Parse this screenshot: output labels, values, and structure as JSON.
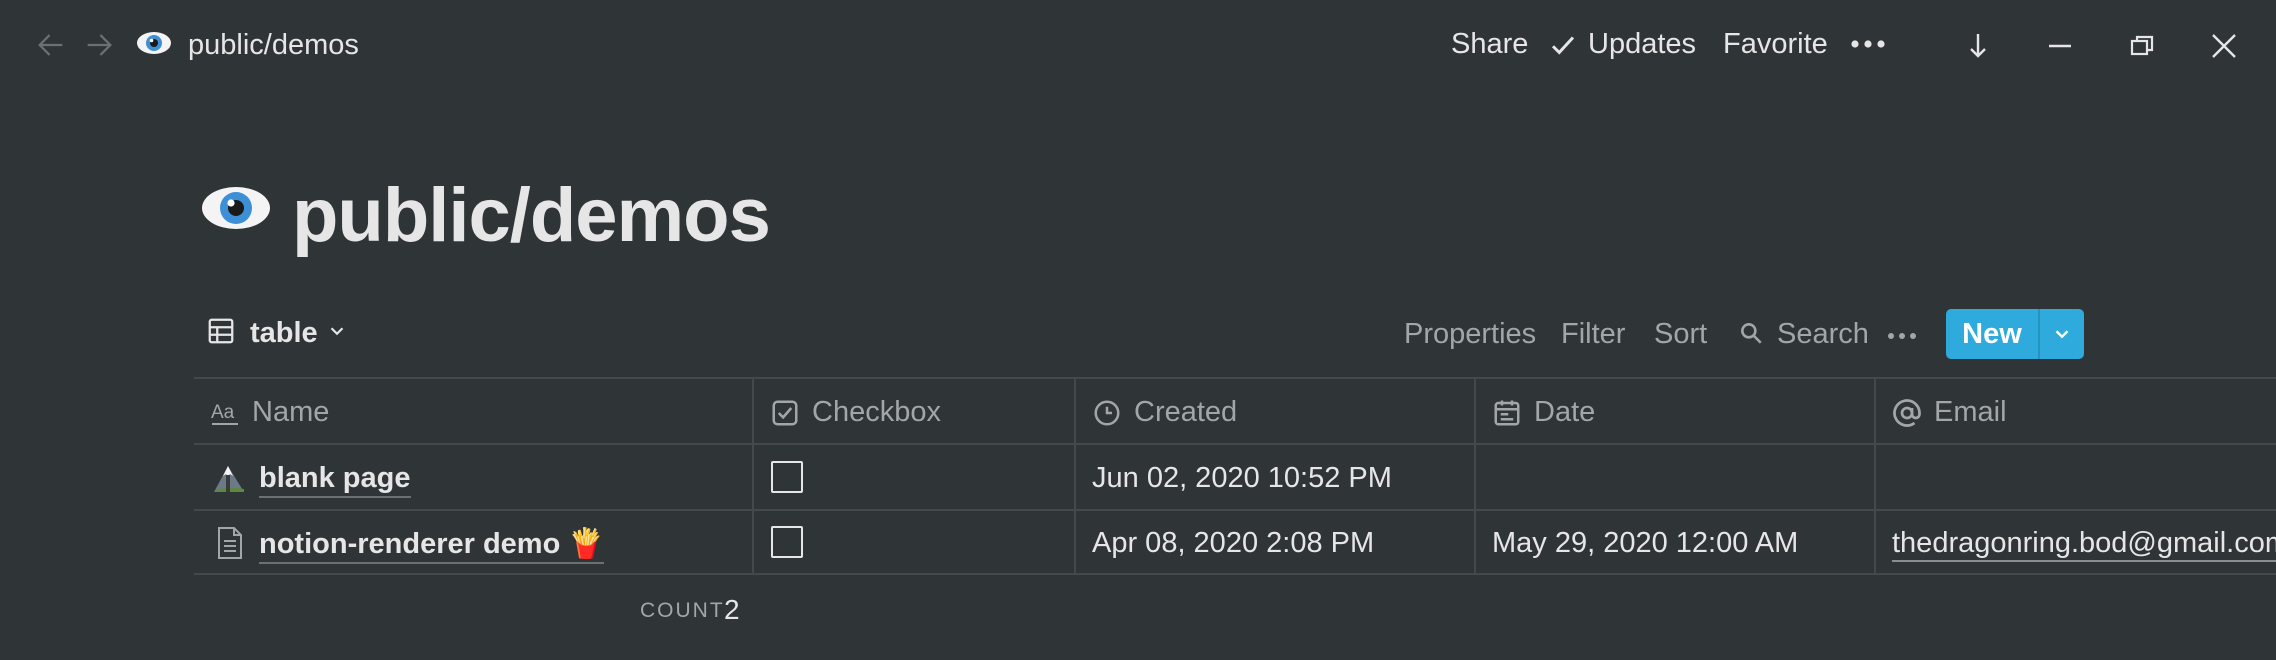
{
  "topbar": {
    "breadcrumb": "public/demos",
    "share": "Share",
    "updates": "Updates",
    "favorite": "Favorite"
  },
  "page": {
    "title": "public/demos",
    "icon": "eye-emoji"
  },
  "view": {
    "label": "table",
    "toolbar": {
      "properties": "Properties",
      "filter": "Filter",
      "sort": "Sort",
      "search": "Search",
      "new": "New"
    }
  },
  "table": {
    "columns": [
      {
        "label": "Name",
        "icon": "text-aa-icon"
      },
      {
        "label": "Checkbox",
        "icon": "checkbox-icon"
      },
      {
        "label": "Created",
        "icon": "clock-icon"
      },
      {
        "label": "Date",
        "icon": "calendar-icon"
      },
      {
        "label": "Email",
        "icon": "at-icon"
      }
    ],
    "rows": [
      {
        "name": "blank page",
        "icon": "mountain-icon",
        "checkbox": false,
        "created": "Jun 02, 2020 10:52 PM",
        "date": "",
        "email": ""
      },
      {
        "name": "notion-renderer demo 🍟",
        "icon": "page-icon",
        "checkbox": false,
        "created": "Apr 08, 2020 2:08 PM",
        "date": "May 29, 2020 12:00 AM",
        "email": "thedragonring.bod@gmail.com"
      }
    ],
    "count_label": "COUNT",
    "count_value": "2"
  },
  "colors": {
    "background": "#2f3437",
    "accent": "#2eaadc",
    "text": "#e6e6e6",
    "muted": "#a3a6a8",
    "border": "#45494c"
  }
}
